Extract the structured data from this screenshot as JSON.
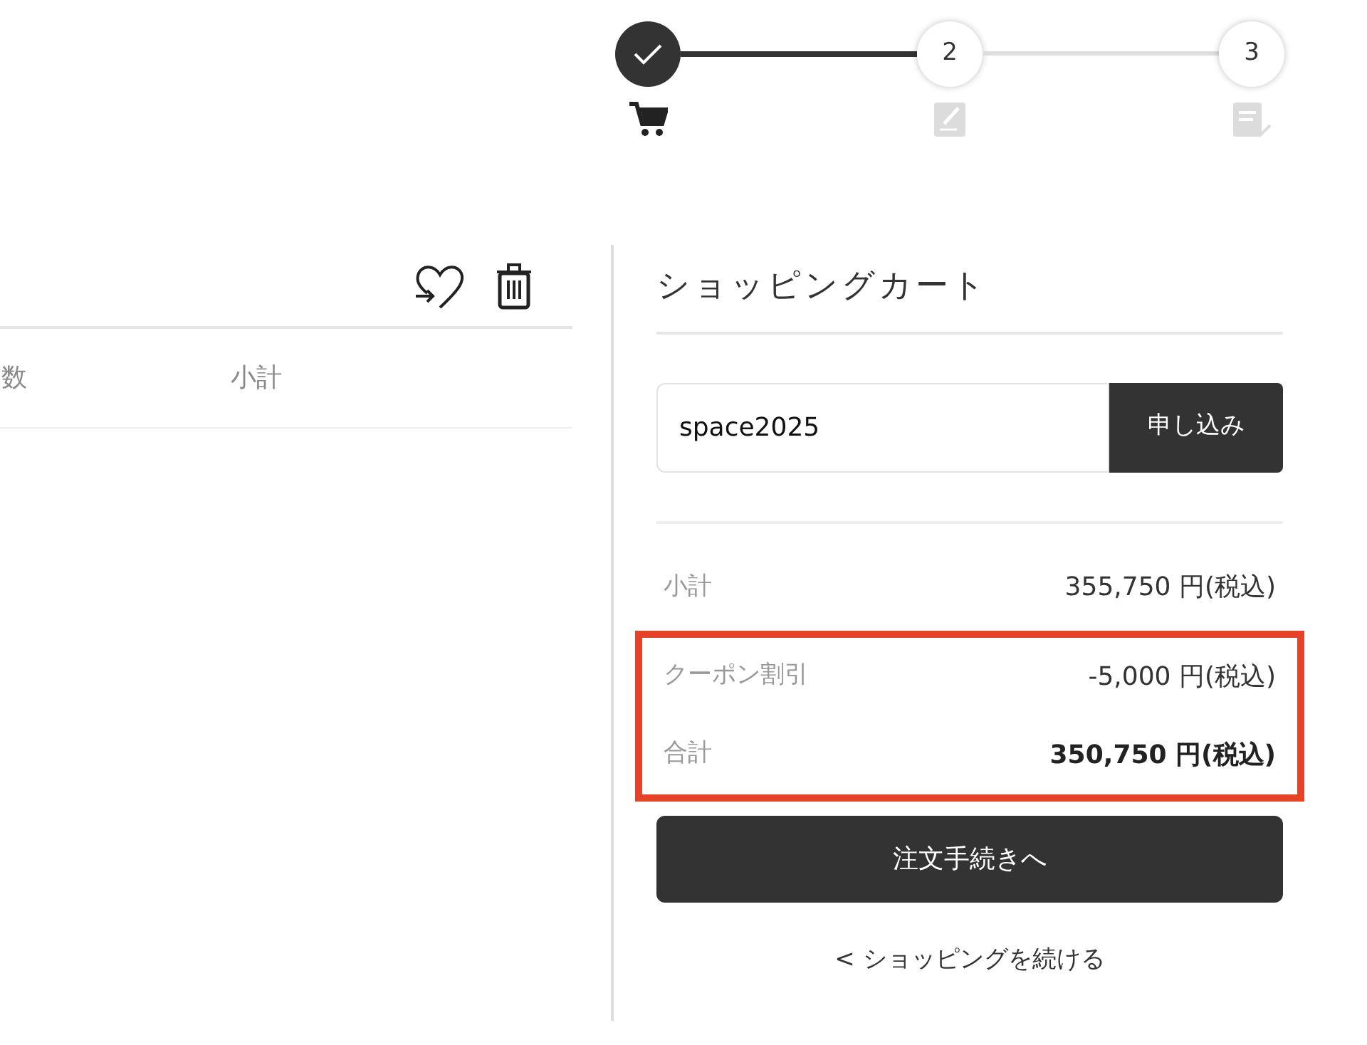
{
  "stepper": {
    "steps": [
      {
        "completed": true,
        "kind": "cart"
      },
      {
        "number": "2",
        "completed": false,
        "kind": "edit"
      },
      {
        "number": "3",
        "completed": false,
        "kind": "confirm"
      }
    ]
  },
  "cart_table": {
    "columns": [
      "数",
      "小計"
    ]
  },
  "summary": {
    "title": "ショッピングカート",
    "coupon": {
      "value": "space2025",
      "button": "申し込み"
    },
    "rows": [
      {
        "label": "小計",
        "amount": "355,750 円(税込)",
        "emphasis": false,
        "highlighted": false
      },
      {
        "label": "クーポン割引",
        "amount": "-5,000 円(税込)",
        "emphasis": false,
        "highlighted": true
      },
      {
        "label": "合計",
        "amount": "350,750 円(税込)",
        "emphasis": true,
        "highlighted": true
      }
    ],
    "checkout_button": "注文手続きへ",
    "continue_link": "< ショッピングを続ける"
  }
}
